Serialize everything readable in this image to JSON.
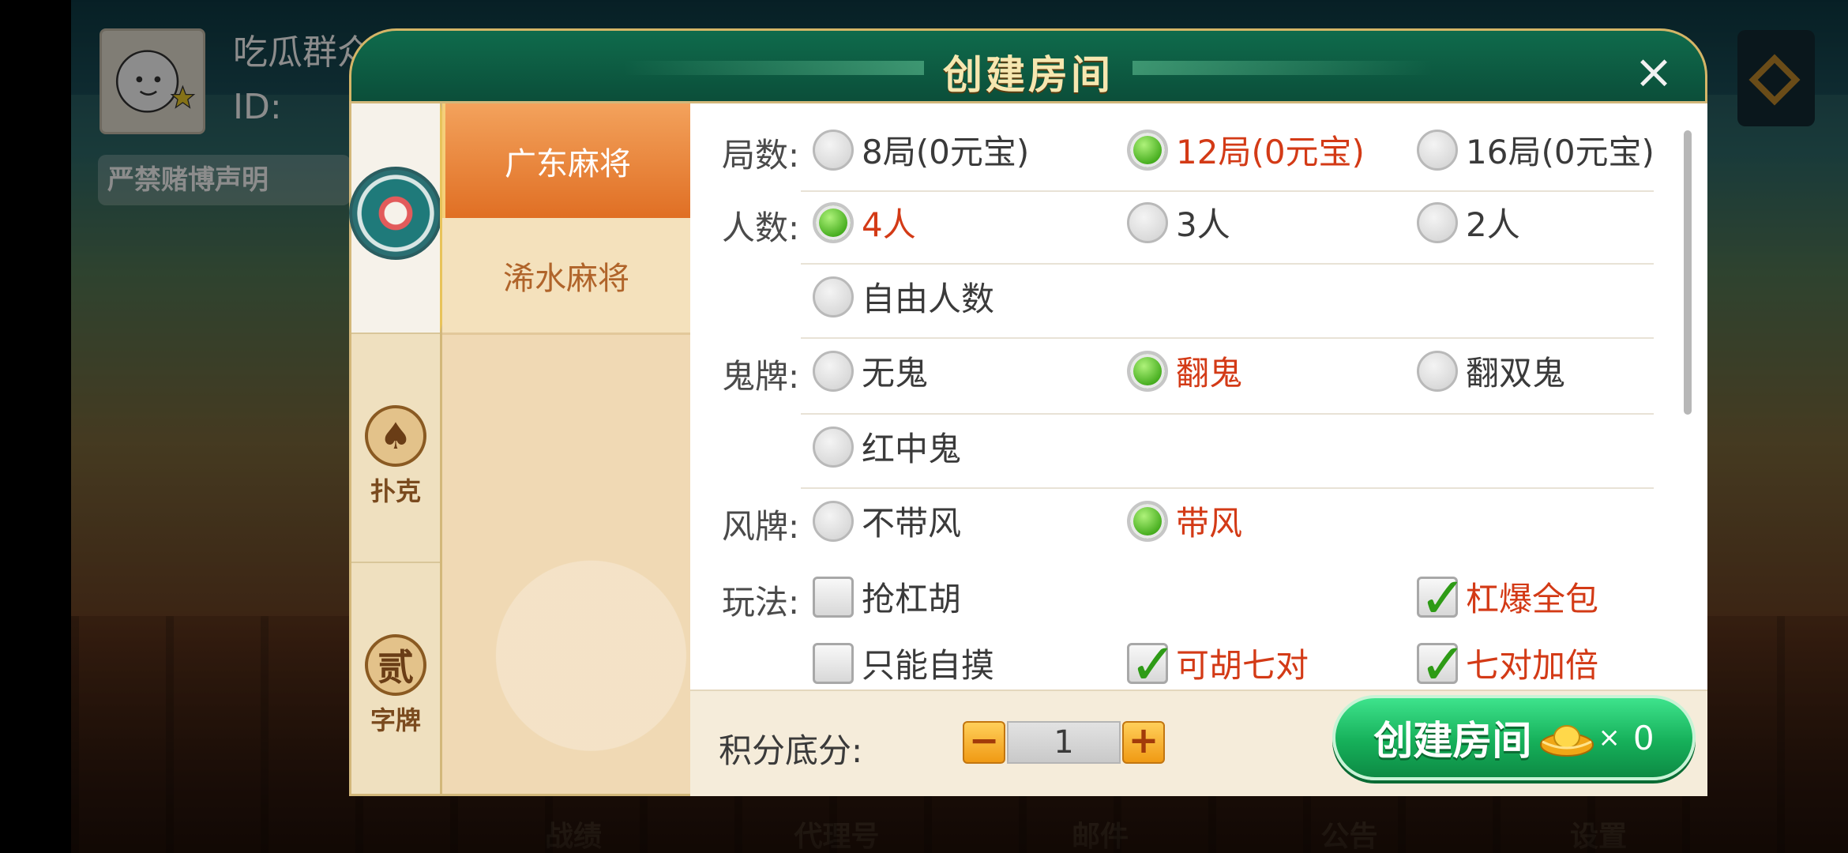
{
  "background": {
    "user_name": "吃瓜群众",
    "user_id": "ID:",
    "notice_banner": "严禁赌博声明",
    "bottom_nav": [
      "战绩",
      "代理号",
      "邮件",
      "公告",
      "设置"
    ]
  },
  "dialog": {
    "title": "创建房间",
    "close_label": "×"
  },
  "categories": [
    {
      "label": "",
      "icon": "mahjong-emblem-icon",
      "active": true
    },
    {
      "label": "扑克",
      "icon": "spade-icon",
      "glyph": "♠"
    },
    {
      "label": "字牌",
      "icon": "zipai-icon",
      "glyph": "贰"
    }
  ],
  "games": [
    {
      "label": "广东麻将",
      "active": true
    },
    {
      "label": "浠水麻将",
      "active": false
    }
  ],
  "options": {
    "rounds": {
      "label": "局数:",
      "choices": [
        "8局(0元宝)",
        "12局(0元宝)",
        "16局(0元宝)"
      ],
      "selected": 1
    },
    "players": {
      "label": "人数:",
      "choices": [
        "4人",
        "3人",
        "2人",
        "自由人数"
      ],
      "selected": 0
    },
    "ghost": {
      "label": "鬼牌:",
      "choices": [
        "无鬼",
        "翻鬼",
        "翻双鬼",
        "红中鬼"
      ],
      "selected": 1
    },
    "wind": {
      "label": "风牌:",
      "choices": [
        "不带风",
        "带风"
      ],
      "selected": 1
    },
    "rules": {
      "label": "玩法:",
      "choices": [
        "抢杠胡",
        "杠爆全包",
        "只能自摸",
        "可胡七对",
        "七对加倍"
      ],
      "checked": [
        false,
        true,
        false,
        true,
        true
      ]
    }
  },
  "footer": {
    "score_label": "积分底分:",
    "minus": "−",
    "plus": "+",
    "score_value": "1",
    "create_label": "创建房间",
    "times": "×",
    "cost": "0"
  },
  "colors": {
    "accent_selected_text": "#d33a16",
    "create_button": "#16b05a",
    "title_bar": "#0f6b4c"
  }
}
